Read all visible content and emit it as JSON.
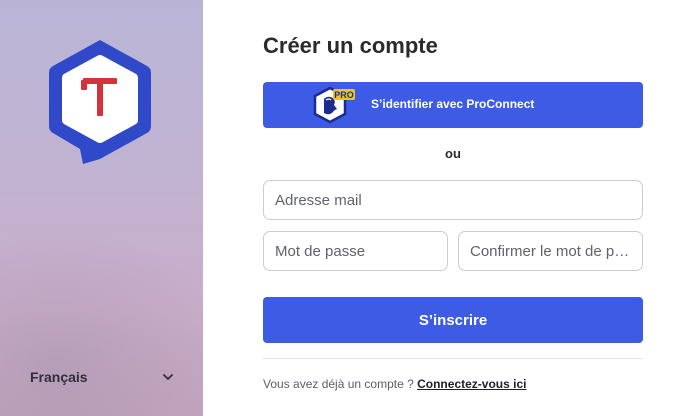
{
  "sidebar": {
    "logo_letter": "T",
    "logo_icon": "speech-bubble-hexagon-logo",
    "language": {
      "label": "Français",
      "icon": "chevron-down-icon"
    }
  },
  "main": {
    "title": "Créer un compte",
    "proconnect": {
      "label": "S’identifier avec ProConnect",
      "badge": "PRO",
      "icon": "proconnect-marianne-icon"
    },
    "separator": "ou",
    "email": {
      "placeholder": "Adresse mail",
      "value": ""
    },
    "password": {
      "placeholder": "Mot de passe",
      "value": ""
    },
    "confirm_password": {
      "placeholder": "Confirmer le mot de passe",
      "value": ""
    },
    "submit_label": "S’inscrire",
    "login_prompt": "Vous avez déjà un compte ? ",
    "login_link": "Connectez-vous ici"
  },
  "colors": {
    "accent": "#3d5be4",
    "logo_blue": "#2f49c9",
    "logo_red": "#d6323c",
    "sidebar_top": "#b9b4d6",
    "sidebar_bottom": "#c2a3bc"
  }
}
